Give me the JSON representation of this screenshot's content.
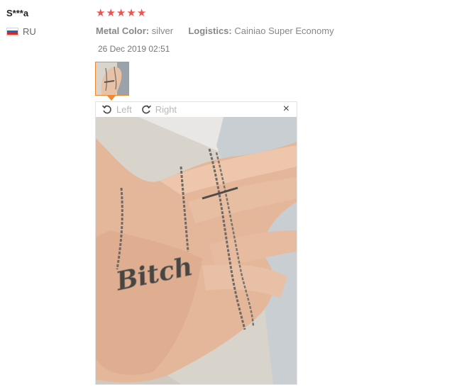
{
  "review": {
    "user_name": "S***a",
    "country": "RU",
    "rating": 5,
    "stars": [
      "★",
      "★",
      "★",
      "★",
      "★"
    ],
    "attributes": [
      {
        "label": "Metal Color:",
        "value": "silver"
      },
      {
        "label": "Logistics:",
        "value": "Cainiao Super Economy"
      }
    ],
    "date": "26 Dec 2019 02:51"
  },
  "viewer": {
    "rotate_left_label": "Left",
    "rotate_right_label": "Right",
    "close_label": "×",
    "image_text": "Bitch"
  },
  "colors": {
    "star": "#ef5350",
    "thumb_border": "#f0892d",
    "toolbar_text": "#b8b8b8"
  }
}
